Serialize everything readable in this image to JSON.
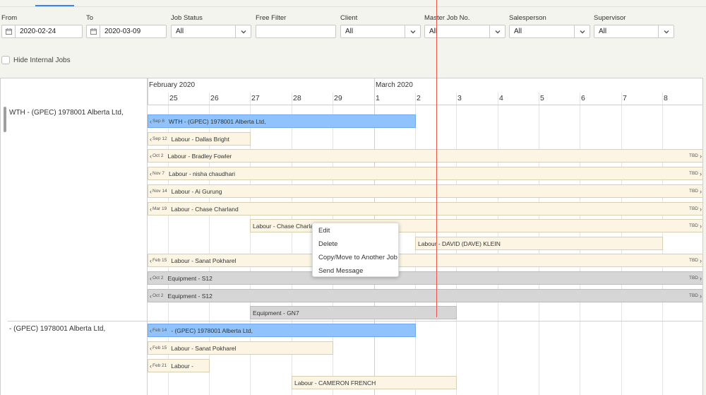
{
  "filters": {
    "from": {
      "label": "From",
      "value": "2020-02-24"
    },
    "to": {
      "label": "To",
      "value": "2020-03-09"
    },
    "job_status": {
      "label": "Job Status",
      "value": "All"
    },
    "free_filter": {
      "label": "Free Filter",
      "value": ""
    },
    "client": {
      "label": "Client",
      "value": "All"
    },
    "master_job": {
      "label": "Master Job No.",
      "value": "All"
    },
    "salesperson": {
      "label": "Salesperson",
      "value": "All"
    },
    "supervisor": {
      "label": "Supervisor",
      "value": "All"
    }
  },
  "hide_internal": {
    "label": "Hide Internal Jobs",
    "checked": false
  },
  "timeline": {
    "months": [
      "February 2020",
      "March 2020"
    ],
    "days": [
      "25",
      "26",
      "27",
      "28",
      "29",
      "1",
      "2",
      "3",
      "4",
      "5",
      "6",
      "7",
      "8"
    ]
  },
  "groups": [
    {
      "name": "WTH - (GPEC) 1978001 Alberta Ltd,"
    },
    {
      "name": "- (GPEC) 1978001 Alberta Ltd,"
    }
  ],
  "bars": [
    {
      "label": "WTH - (GPEC) 1978001 Alberta Ltd,",
      "prev": "Sep 8",
      "tbd": "",
      "style": "blue"
    },
    {
      "label": "Labour - Dallas Bright",
      "prev": "Sep 12",
      "tbd": "",
      "style": "beige"
    },
    {
      "label": "Labour - Bradley Fowler",
      "prev": "Oct 2",
      "tbd": "TBD",
      "style": "beige"
    },
    {
      "label": "Labour - nisha chaudhari",
      "prev": "Nov 7",
      "tbd": "TBD",
      "style": "beige"
    },
    {
      "label": "Labour - Ai Gurung",
      "prev": "Nov 14",
      "tbd": "TBD",
      "style": "beige"
    },
    {
      "label": "Labour - Chase Charland",
      "prev": "Mar 19",
      "tbd": "TBD",
      "style": "beige"
    },
    {
      "label": "Labour - Chase Charland",
      "prev": "",
      "tbd": "TBD",
      "style": "beige"
    },
    {
      "label": "Labour - DAVID (DAVE) KLEIN",
      "prev": "",
      "tbd": "",
      "style": "beige"
    },
    {
      "label": "Labour - Sanat Pokharel",
      "prev": "Feb 15",
      "tbd": "TBD",
      "style": "beige"
    },
    {
      "label": "Equipment - S12",
      "prev": "Oct 2",
      "tbd": "TBD",
      "style": "gray"
    },
    {
      "label": "Equipment - S12",
      "prev": "Oct 2",
      "tbd": "TBD",
      "style": "gray"
    },
    {
      "label": "Equipment - GN7",
      "prev": "",
      "tbd": "",
      "style": "gray"
    },
    {
      "label": "- (GPEC) 1978001 Alberta Ltd,",
      "prev": "Feb 14",
      "tbd": "",
      "style": "blue"
    },
    {
      "label": "Labour - Sanat Pokharel",
      "prev": "Feb 15",
      "tbd": "",
      "style": "beige"
    },
    {
      "label": "Labour -",
      "prev": "Feb 21",
      "tbd": "",
      "style": "beige"
    },
    {
      "label": "Labour - CAMERON FRENCH",
      "prev": "",
      "tbd": "",
      "style": "beige"
    }
  ],
  "context_menu": {
    "items": [
      "Edit",
      "Delete",
      "Copy/Move to Another Job",
      "Send Message"
    ]
  },
  "colors": {
    "accent": "#3b82f6",
    "today_line": "#e4574f",
    "bar_blue": "#90c3fb",
    "bar_beige": "#fcf5e3",
    "bar_gray": "#d6d6d6"
  },
  "icons": {
    "calendar": "calendar-icon",
    "dropdown": "chevron-down-icon",
    "previous": "chevron-left-icon",
    "next": "chevron-right-icon"
  }
}
